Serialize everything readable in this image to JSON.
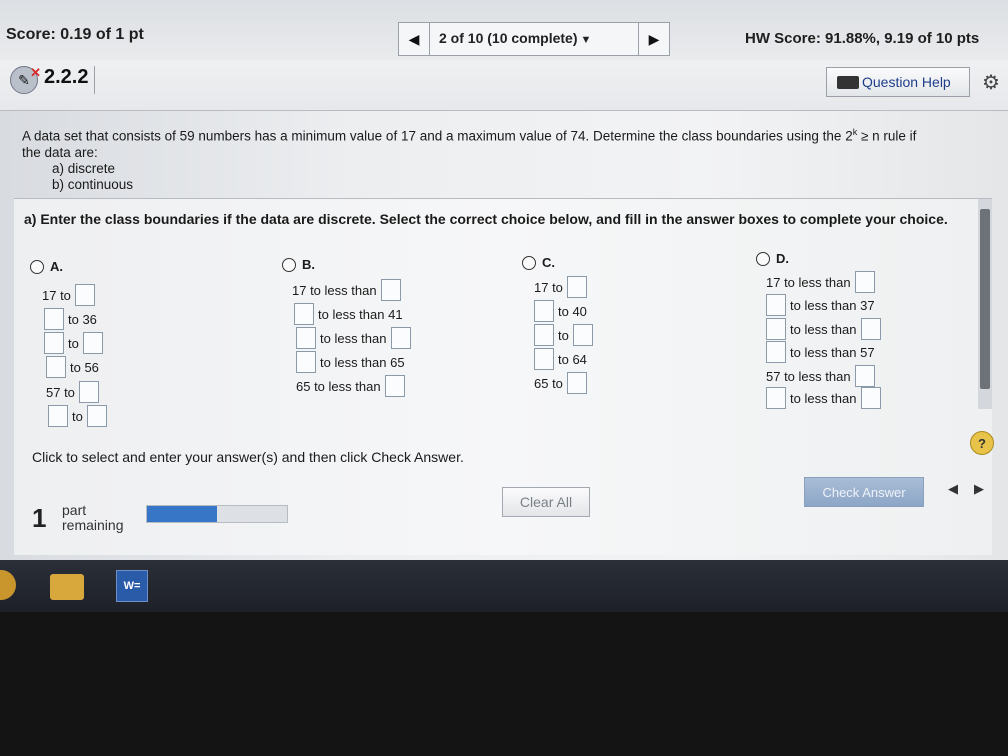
{
  "header": {
    "score": "Score: 0.19 of 1 pt",
    "progress": "2 of 10 (10 complete)",
    "hw_score": "HW Score: 91.88%, 9.19 of 10 pts"
  },
  "question_header": {
    "number": "2.2.2",
    "help_label": "Question Help"
  },
  "question": {
    "line1": "A data set that consists of 59 numbers has a minimum value of 17 and a maximum value of 74. Determine the class boundaries using the 2",
    "sup": "k",
    "line1_end": " ≥ n rule if",
    "line2": "the data are:",
    "item_a": "a) discrete",
    "item_b": "b) continuous"
  },
  "part_a": {
    "instruction": "a) Enter the class boundaries if the data are discrete. Select the correct choice below, and fill in the answer boxes to complete your choice.",
    "choices": [
      {
        "label": "A.",
        "rows": [
          "17 to",
          "to 36",
          "to",
          "to 56",
          "57 to",
          "to"
        ]
      },
      {
        "label": "B.",
        "rows": [
          "17 to less than",
          "to less than 41",
          "to less than",
          "to less than 65",
          "65 to less than"
        ]
      },
      {
        "label": "C.",
        "rows": [
          "17 to",
          "to 40",
          "to",
          "to 64",
          "65 to"
        ]
      },
      {
        "label": "D.",
        "rows": [
          "17 to less than",
          "to less than 37",
          "to less than",
          "to less than 57",
          "57 to less than",
          "to less than"
        ]
      }
    ]
  },
  "footer": {
    "click_text": "Click to select and enter your answer(s) and then click Check Answer.",
    "parts_count": "1",
    "parts_line1": "part",
    "parts_line2": "remaining",
    "progress_fraction": 0.5,
    "clear_all": "Clear All",
    "check_answer": "Check Answer"
  },
  "taskbar": {
    "word_icon": "W="
  },
  "colors": {
    "accent": "#3775c7",
    "check_button": "#8da6c7",
    "help_icon": "#e8c34a"
  }
}
